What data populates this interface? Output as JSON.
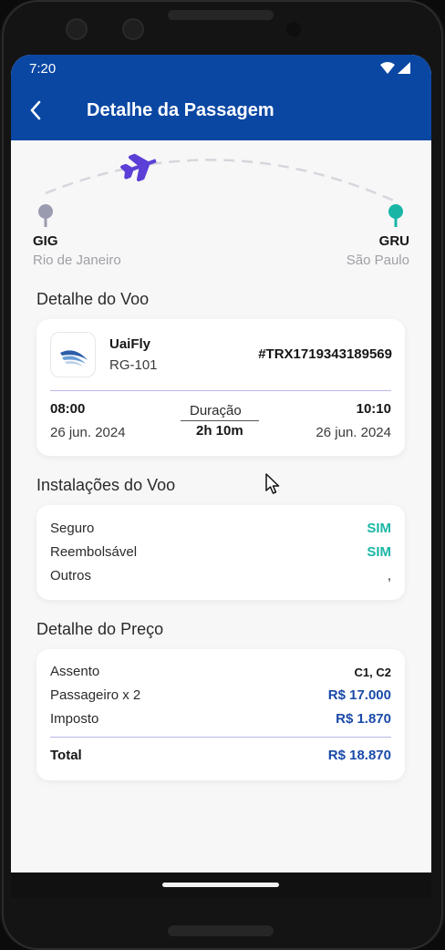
{
  "status_bar": {
    "time": "7:20"
  },
  "header": {
    "title": "Detalhe da Passagem"
  },
  "route": {
    "origin": {
      "code": "GIG",
      "city": "Rio de Janeiro"
    },
    "destination": {
      "code": "GRU",
      "city": "São Paulo"
    }
  },
  "flight_section": {
    "title": "Detalhe do Voo",
    "airline": "UaiFly",
    "flight_number": "RG-101",
    "ticket_id": "#TRX1719343189569",
    "departure": {
      "time": "08:00",
      "date": "26 jun. 2024"
    },
    "arrival": {
      "time": "10:10",
      "date": "26 jun. 2024"
    },
    "duration_label": "Duração",
    "duration_value": "2h 10m"
  },
  "facilities_section": {
    "title": "Instalações do Voo",
    "rows": [
      {
        "label": "Seguro",
        "value": "SIM"
      },
      {
        "label": "Reembolsável",
        "value": "SIM"
      },
      {
        "label": "Outros",
        "value": ","
      }
    ]
  },
  "price_section": {
    "title": "Detalhe do Preço",
    "seat_label": "Assento",
    "seat_value": "C1, C2",
    "passengers_label": "Passageiro x 2",
    "passengers_value": "R$  17.000",
    "tax_label": "Imposto",
    "tax_value": "R$  1.870",
    "total_label": "Total",
    "total_value": "R$  18.870"
  },
  "colors": {
    "header_bg": "#0a47a3",
    "accent_purple": "#5b3fd6",
    "origin_pin": "#9b9bb0",
    "destination_pin": "#19b6a6",
    "price_blue": "#1a4aa8",
    "yes_green": "#19b6a6"
  },
  "icons": {
    "back": "chevron-left-icon",
    "plane": "airplane-icon",
    "wifi": "wifi-icon",
    "signal": "signal-icon",
    "airline_logo": "airline-logo-icon",
    "cursor": "mouse-cursor-icon"
  }
}
